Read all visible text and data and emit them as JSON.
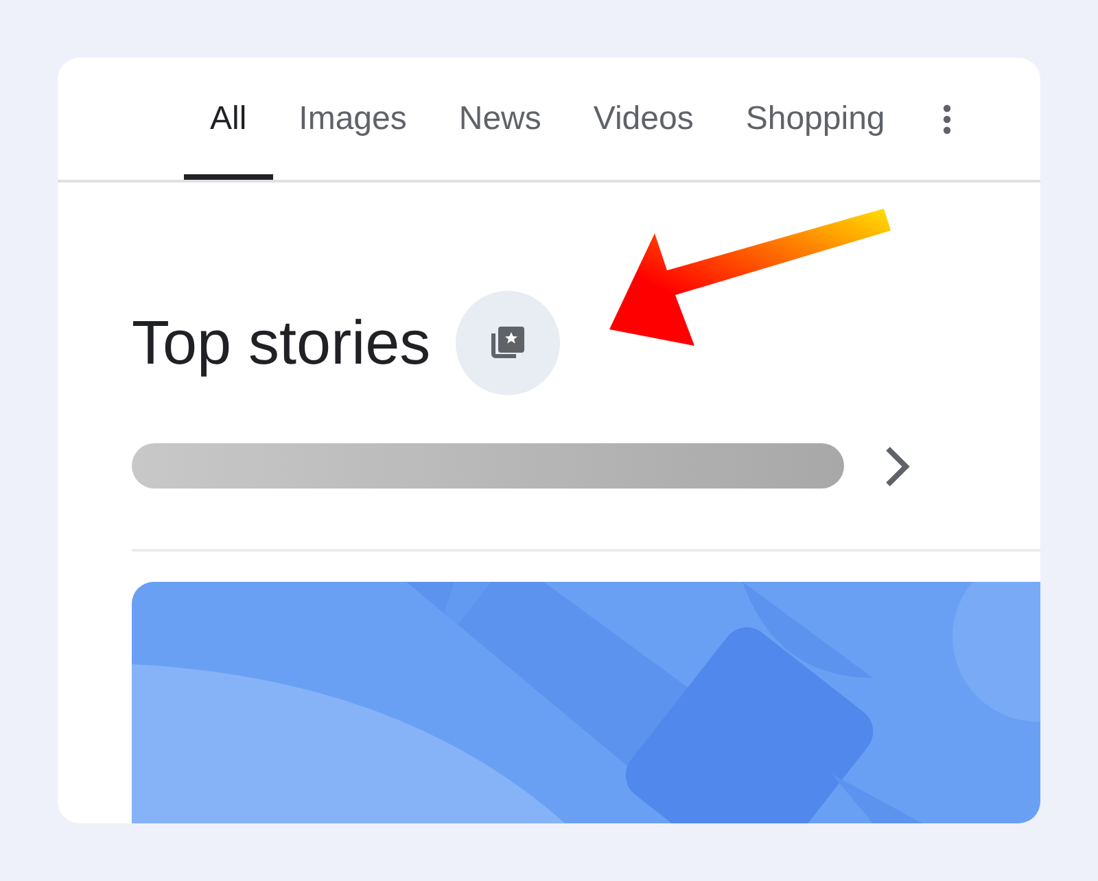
{
  "tabs": [
    {
      "label": "All",
      "selected": true
    },
    {
      "label": "Images",
      "selected": false
    },
    {
      "label": "News",
      "selected": false
    },
    {
      "label": "Videos",
      "selected": false
    },
    {
      "label": "Shopping",
      "selected": false
    }
  ],
  "section": {
    "title": "Top stories"
  }
}
